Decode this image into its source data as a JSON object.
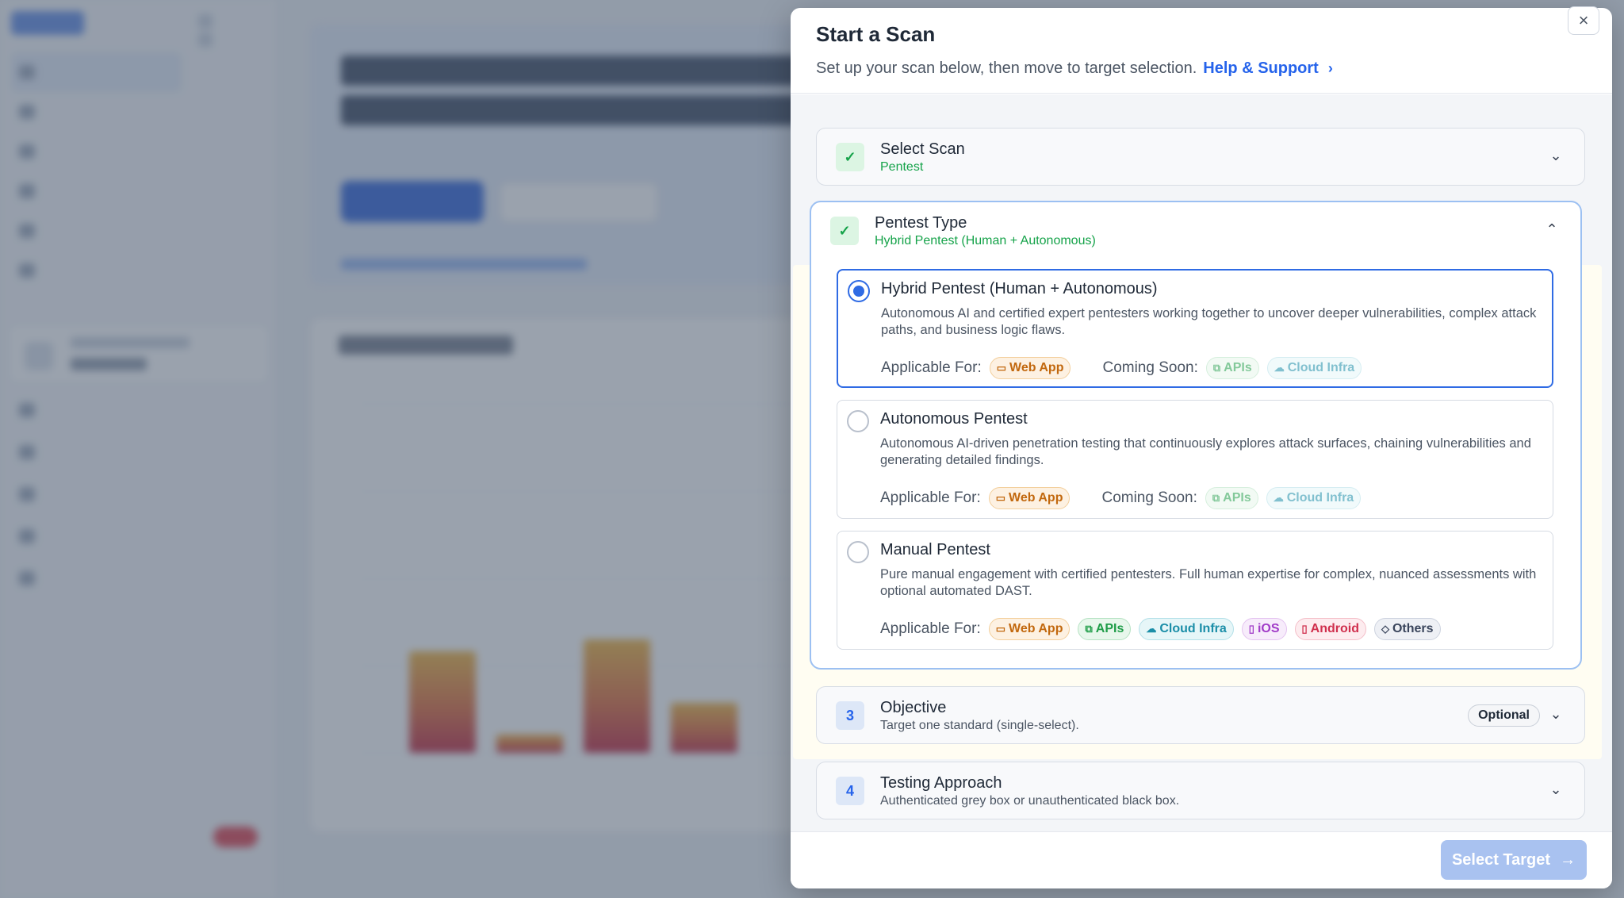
{
  "modal": {
    "title": "Start a Scan",
    "subtitle": "Set up your scan below, then move to target selection.",
    "help_link": "Help & Support",
    "close_glyph": "×"
  },
  "steps": [
    {
      "title": "Select Scan",
      "subtitle": "Pentest",
      "state": "complete"
    },
    {
      "title": "Pentest Type",
      "subtitle": "Hybrid Pentest (Human + Autonomous)",
      "state": "complete",
      "expanded": true
    },
    {
      "number": "3",
      "title": "Objective",
      "subtitle": "Target one standard (single-select).",
      "badge": "Optional"
    },
    {
      "number": "4",
      "title": "Testing Approach",
      "subtitle": "Authenticated grey box or unauthenticated black box."
    }
  ],
  "pentest_options": [
    {
      "title": "Hybrid Pentest (Human + Autonomous)",
      "description": "Autonomous AI and certified expert pentesters working together to uncover deeper vulnerabilities, complex attack paths, and business logic flaws.",
      "selected": true,
      "applicable_label": "Applicable For:",
      "applicable": [
        "Web App"
      ],
      "coming_soon_label": "Coming Soon:",
      "coming_soon": [
        "APIs",
        "Cloud Infra"
      ]
    },
    {
      "title": "Autonomous Pentest",
      "description": "Autonomous AI-driven penetration testing that continuously explores attack surfaces, chaining vulnerabilities and generating detailed findings.",
      "selected": false,
      "applicable_label": "Applicable For:",
      "applicable": [
        "Web App"
      ],
      "coming_soon_label": "Coming Soon:",
      "coming_soon": [
        "APIs",
        "Cloud Infra"
      ]
    },
    {
      "title": "Manual Pentest",
      "description": "Pure manual engagement with certified pentesters. Full human expertise for complex, nuanced assessments with optional automated DAST.",
      "selected": false,
      "applicable_label": "Applicable For:",
      "applicable": [
        "Web App",
        "APIs",
        "Cloud Infra",
        "iOS",
        "Android",
        "Others"
      ]
    }
  ],
  "footer": {
    "primary_button": "Select Target",
    "primary_enabled": false
  },
  "colors": {
    "accent": "#2f6be4",
    "success": "#16a34a",
    "scrim": "#475569"
  }
}
